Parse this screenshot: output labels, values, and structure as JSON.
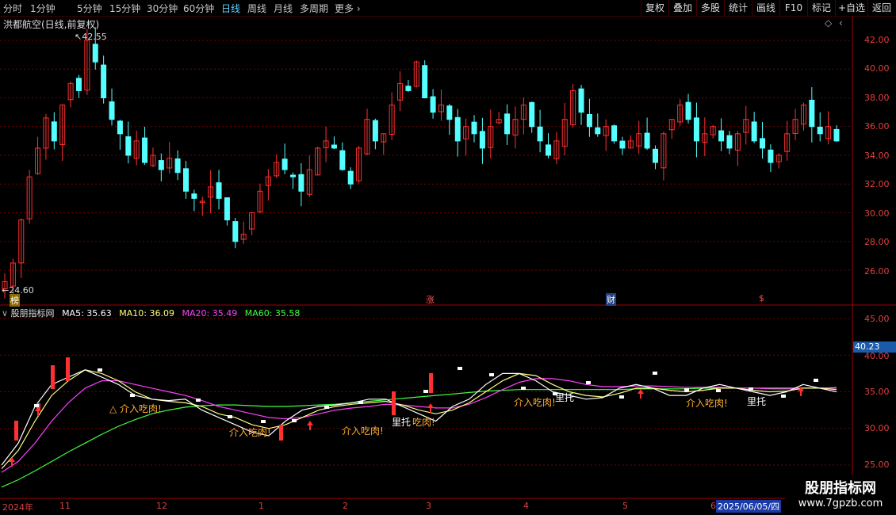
{
  "toolbar": {
    "periods": [
      "分时",
      "1分钟",
      "5分钟",
      "15分钟",
      "30分钟",
      "60分钟",
      "日线",
      "周线",
      "月线",
      "多周期",
      "更多"
    ],
    "active_period": "日线",
    "right_buttons": [
      "复权",
      "叠加",
      "多股",
      "统计",
      "画线",
      "F10",
      "标记",
      "+自选",
      "返回"
    ]
  },
  "stock_title": "洪都航空(日线,前复权)",
  "price_axis": [
    "42.00",
    "40.00",
    "38.00",
    "36.00",
    "34.00",
    "32.00",
    "30.00",
    "28.00",
    "26.00"
  ],
  "high_label": "42.55",
  "low_label": "24.60",
  "event_tags": [
    "榜",
    "涨",
    "财",
    "$"
  ],
  "indicator": {
    "name": "股朋指标网",
    "ma5_label": "MA5: 35.63",
    "ma10_label": "MA10: 36.09",
    "ma20_label": "MA20: 35.49",
    "ma60_label": "MA60: 35.58",
    "axis": [
      "45.00",
      "40.00",
      "35.00",
      "30.00",
      "25.00"
    ],
    "current_value": "40.23",
    "annotations": [
      "△ 介入吃肉!",
      "介入吃肉!",
      "介入吃肉!",
      "里托",
      "吃肉!",
      "介入吃肉!",
      "里托",
      "介入吃肉!",
      "里托"
    ]
  },
  "dates": {
    "year": "2024年",
    "months": [
      "11",
      "12",
      "1",
      "2",
      "3",
      "4",
      "5",
      "6"
    ],
    "current": "2025/06/05/四"
  },
  "watermark": {
    "title": "股朋指标网",
    "url": "www.7gpzb.com"
  },
  "colors": {
    "up": "#ff3030",
    "down": "#54ffff",
    "ma5": "#ffffff",
    "ma10": "#ffff80",
    "ma20": "#ff40ff",
    "ma60": "#40ff40",
    "grid": "#7a0000"
  },
  "chart_data": {
    "type": "candlestick",
    "title": "洪都航空(日线,前复权)",
    "ylim": [
      24,
      43
    ],
    "high": 42.55,
    "low": 24.6,
    "close_path": [
      25.2,
      26.5,
      29.5,
      32.5,
      34.5,
      36.6,
      35.0,
      37.5,
      39.0,
      38.5,
      42.0,
      40.5,
      38.0,
      36.5,
      35.5,
      34.0,
      35.0,
      33.5,
      34.0,
      33.0,
      33.8,
      32.8,
      31.5,
      31.0,
      30.8,
      31.8,
      31.0,
      29.5,
      28.0,
      28.5,
      30.0,
      31.5,
      32.5,
      33.5,
      33.0,
      32.5,
      31.5,
      33.0,
      34.5,
      35.0,
      34.5,
      33.0,
      32.0,
      34.5,
      36.5,
      35.0,
      35.5,
      37.5,
      39.0,
      38.5,
      40.5,
      38.0,
      37.0,
      37.5,
      36.5,
      35.0,
      36.0,
      35.5,
      34.5,
      36.0,
      36.5,
      35.5,
      36.5,
      37.5,
      36.0,
      35.0,
      34.0,
      35.0,
      36.5,
      38.5,
      37.0,
      36.0,
      35.5,
      36.0,
      35.0,
      34.5,
      35.0,
      35.5,
      34.5,
      33.5,
      35.5,
      36.5,
      37.5,
      36.5,
      35.0,
      35.5,
      36.0,
      35.0,
      34.5,
      35.5,
      36.5,
      35.0,
      34.5,
      33.5,
      34.0,
      35.5,
      36.5,
      37.5,
      36.0,
      35.5,
      36.0,
      35.0
    ],
    "ma5": [
      25,
      28,
      33,
      36,
      37,
      38,
      37,
      36,
      34.5,
      34,
      33.8,
      34,
      32.5,
      31.5,
      30.5,
      29.5,
      29,
      31,
      32.5,
      33,
      33.2,
      33.5,
      34,
      34,
      33,
      32,
      31,
      33,
      34,
      36,
      37.5,
      37.5,
      36.5,
      35,
      34.5,
      34,
      34.2,
      35.5,
      36,
      35.5,
      34.5,
      34.5,
      35.5,
      36,
      35.5,
      35,
      34.5,
      35,
      36,
      35.5,
      35
    ],
    "ma10": [
      24.5,
      27,
      31,
      34.5,
      36.5,
      38,
      37.5,
      36.5,
      35,
      34,
      33.7,
      33.5,
      33,
      32,
      31.5,
      30.5,
      30,
      30.5,
      31.5,
      32.5,
      33,
      33.3,
      33.5,
      33.7,
      33.2,
      32.5,
      32,
      32.5,
      33.5,
      35,
      36.5,
      37.5,
      37.2,
      36,
      35,
      34.5,
      34.3,
      34.8,
      35.5,
      35.5,
      35.2,
      35,
      35.2,
      35.5,
      35.5,
      35.2,
      35,
      35.1,
      35.5,
      35.5,
      35.3
    ],
    "ma20": [
      24,
      25.5,
      28,
      31,
      33.5,
      35.5,
      36.5,
      36.5,
      36,
      35.5,
      35,
      34.5,
      33.8,
      33,
      32.5,
      32,
      31.5,
      31.3,
      31.5,
      32,
      32.5,
      32.8,
      33,
      33.3,
      33.2,
      33,
      32.8,
      32.8,
      33.3,
      34.2,
      35.3,
      36.3,
      36.8,
      36.8,
      36.5,
      36,
      35.7,
      35.7,
      35.8,
      35.8,
      35.7,
      35.6,
      35.6,
      35.6,
      35.5,
      35.5,
      35.4,
      35.4,
      35.5,
      35.5,
      35.5
    ],
    "ma60": [
      22,
      23,
      24.2,
      25.5,
      26.8,
      28,
      29.2,
      30.3,
      31.2,
      32,
      32.5,
      32.9,
      33.1,
      33.2,
      33.2,
      33.1,
      33,
      33,
      33.1,
      33.2,
      33.3,
      33.5,
      33.7,
      33.9,
      34.1,
      34.3,
      34.5,
      34.7,
      34.9,
      35.1,
      35.2,
      35.3,
      35.3,
      35.3,
      35.3,
      35.3,
      35.3,
      35.3,
      35.4,
      35.4,
      35.4,
      35.4,
      35.5,
      35.5,
      35.5,
      35.5,
      35.5,
      35.5,
      35.5,
      35.5,
      35.58
    ]
  }
}
